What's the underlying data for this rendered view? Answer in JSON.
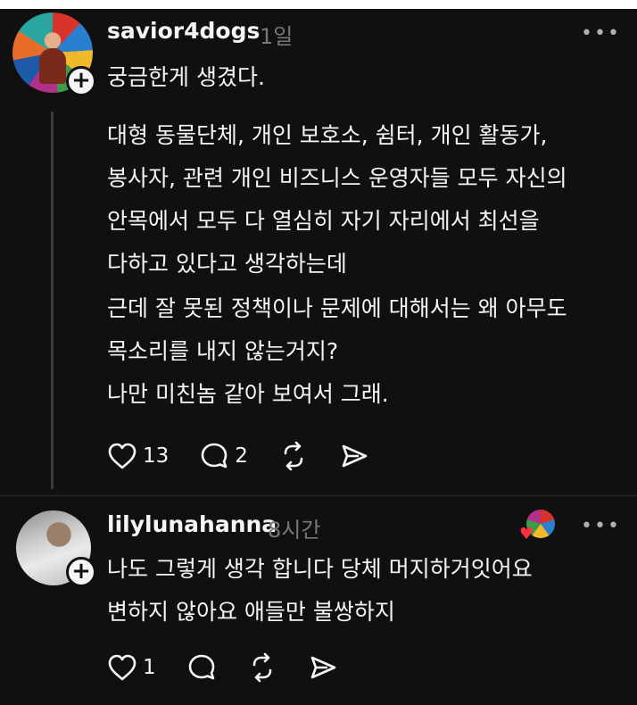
{
  "post": {
    "username": "savior4dogs",
    "time": "1일",
    "more": "•••",
    "first_line": "궁금한게 생겼다.",
    "paragraphs": [
      [
        "대형 동물단체, 개인 보호소, 쉼터, 개인 활동가,",
        "봉사자, 관련 개인 비즈니스 운영자들 모두 자신의",
        "안목에서 모두 다 열심히 자기 자리에서 최선을",
        "다하고 있다고 생각하는데"
      ],
      [
        "근데 잘 못된 정책이나 문제에 대해서는 왜 아무도",
        "목소리를 내지 않는거지?"
      ],
      [
        "나만 미친놈 같아 보여서 그래."
      ]
    ],
    "likes": "13",
    "comments": "2"
  },
  "reply": {
    "username": "lilylunahanna",
    "time": "8시간",
    "more": "•••",
    "lines": [
      "나도 그렇게 생각 합니다 당체 머지하거잇어요",
      "변하지 않아요 애들만 불쌍하지"
    ],
    "likes": "1"
  },
  "icons": {
    "like": "heart-icon",
    "comment": "comment-icon",
    "repost": "repost-icon",
    "share": "share-icon",
    "follow": "plus-icon"
  },
  "colors": {
    "background": "#101010",
    "text": "#f3f5f7",
    "muted": "#777777",
    "like_badge": "#ff3040"
  }
}
